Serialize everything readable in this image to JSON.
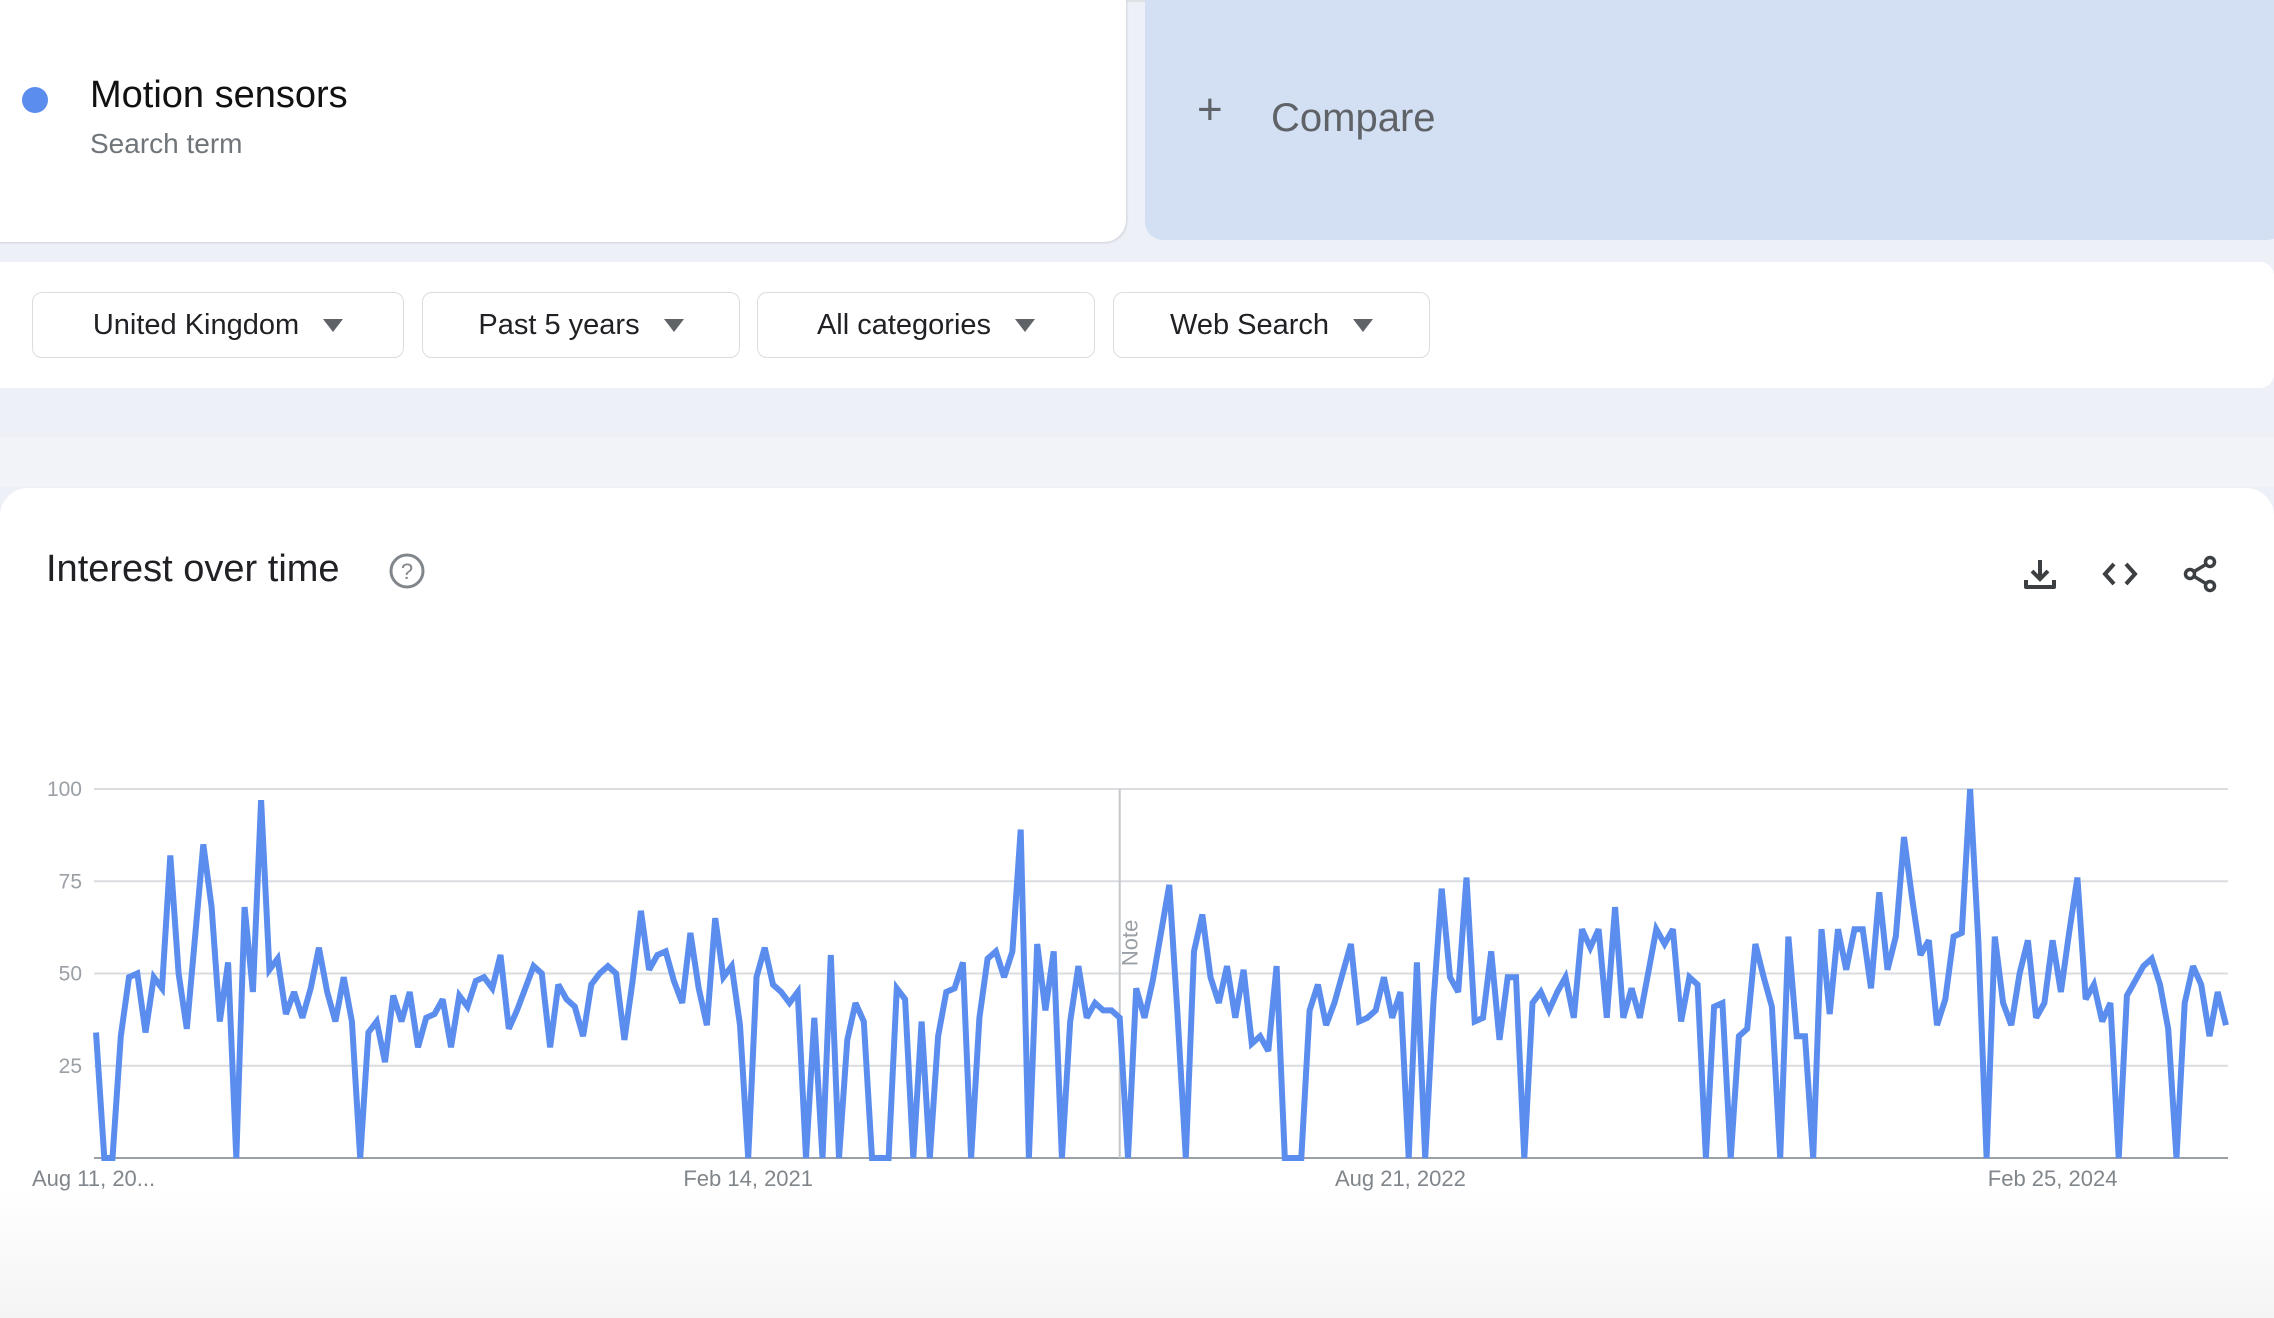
{
  "search_term": {
    "name": "Motion sensors",
    "type": "Search term",
    "color": "#5b8def"
  },
  "compare": {
    "icon": "plus-icon",
    "label": "Compare"
  },
  "filters": [
    {
      "label": "United Kingdom",
      "icon": "caret-down-icon"
    },
    {
      "label": "Past 5 years",
      "icon": "caret-down-icon"
    },
    {
      "label": "All categories",
      "icon": "caret-down-icon"
    },
    {
      "label": "Web Search",
      "icon": "caret-down-icon"
    }
  ],
  "interest_panel": {
    "title": "Interest over time",
    "help_icon": "help-circle-icon",
    "actions": [
      {
        "name": "download",
        "icon": "download-icon"
      },
      {
        "name": "embed",
        "icon": "code-icon"
      },
      {
        "name": "share",
        "icon": "share-icon"
      }
    ]
  },
  "chart_data": {
    "type": "line",
    "title": "Interest over time",
    "xlabel": "",
    "ylabel": "",
    "ylim": [
      0,
      100
    ],
    "y_ticks": [
      25,
      50,
      75,
      100
    ],
    "x_tick_labels": [
      "Aug 11, 20...",
      "Feb 14, 2021",
      "Aug 21, 2022",
      "Feb 25, 2024"
    ],
    "x_tick_positions": [
      0,
      79,
      158,
      237
    ],
    "grid": true,
    "legend": "none",
    "annotation": {
      "label": "Note",
      "index": 124
    },
    "series": [
      {
        "name": "Motion sensors",
        "color": "#5b8def",
        "values": [
          34,
          0,
          0,
          33,
          49,
          50,
          34,
          49,
          46,
          82,
          50,
          35,
          60,
          85,
          68,
          37,
          53,
          0,
          68,
          45,
          97,
          51,
          54,
          39,
          45,
          38,
          46,
          57,
          45,
          37,
          49,
          37,
          0,
          34,
          37,
          26,
          44,
          37,
          45,
          30,
          38,
          39,
          43,
          30,
          44,
          41,
          48,
          49,
          46,
          55,
          35,
          40,
          46,
          52,
          50,
          30,
          47,
          43,
          41,
          33,
          47,
          50,
          52,
          50,
          32,
          48,
          67,
          51,
          55,
          56,
          48,
          42,
          61,
          46,
          36,
          65,
          49,
          52,
          36,
          0,
          49,
          57,
          47,
          45,
          42,
          45,
          0,
          38,
          0,
          55,
          0,
          32,
          42,
          37,
          0,
          0,
          0,
          46,
          43,
          0,
          37,
          0,
          33,
          45,
          46,
          53,
          0,
          38,
          54,
          56,
          49,
          56,
          89,
          0,
          58,
          40,
          56,
          0,
          37,
          52,
          38,
          42,
          40,
          40,
          38,
          0,
          46,
          38,
          48,
          61,
          74,
          39,
          0,
          56,
          66,
          49,
          42,
          52,
          38,
          51,
          31,
          33,
          29,
          52,
          0,
          0,
          0,
          40,
          47,
          36,
          42,
          50,
          58,
          37,
          38,
          40,
          49,
          38,
          45,
          0,
          53,
          0,
          42,
          73,
          49,
          45,
          76,
          37,
          38,
          56,
          32,
          49,
          49,
          0,
          42,
          45,
          40,
          45,
          49,
          38,
          62,
          57,
          62,
          38,
          68,
          38,
          46,
          38,
          50,
          62,
          58,
          62,
          37,
          49,
          47,
          0,
          41,
          42,
          0,
          33,
          35,
          58,
          49,
          41,
          0,
          60,
          33,
          33,
          0,
          62,
          39,
          62,
          51,
          62,
          62,
          46,
          72,
          51,
          60,
          87,
          70,
          55,
          59,
          36,
          43,
          60,
          61,
          100,
          59,
          0,
          60,
          42,
          36,
          50,
          59,
          38,
          42,
          59,
          45,
          61,
          76,
          43,
          47,
          37,
          42,
          0,
          44,
          48,
          52,
          54,
          47,
          35,
          0,
          42,
          52,
          47,
          33,
          45,
          36
        ]
      }
    ]
  }
}
